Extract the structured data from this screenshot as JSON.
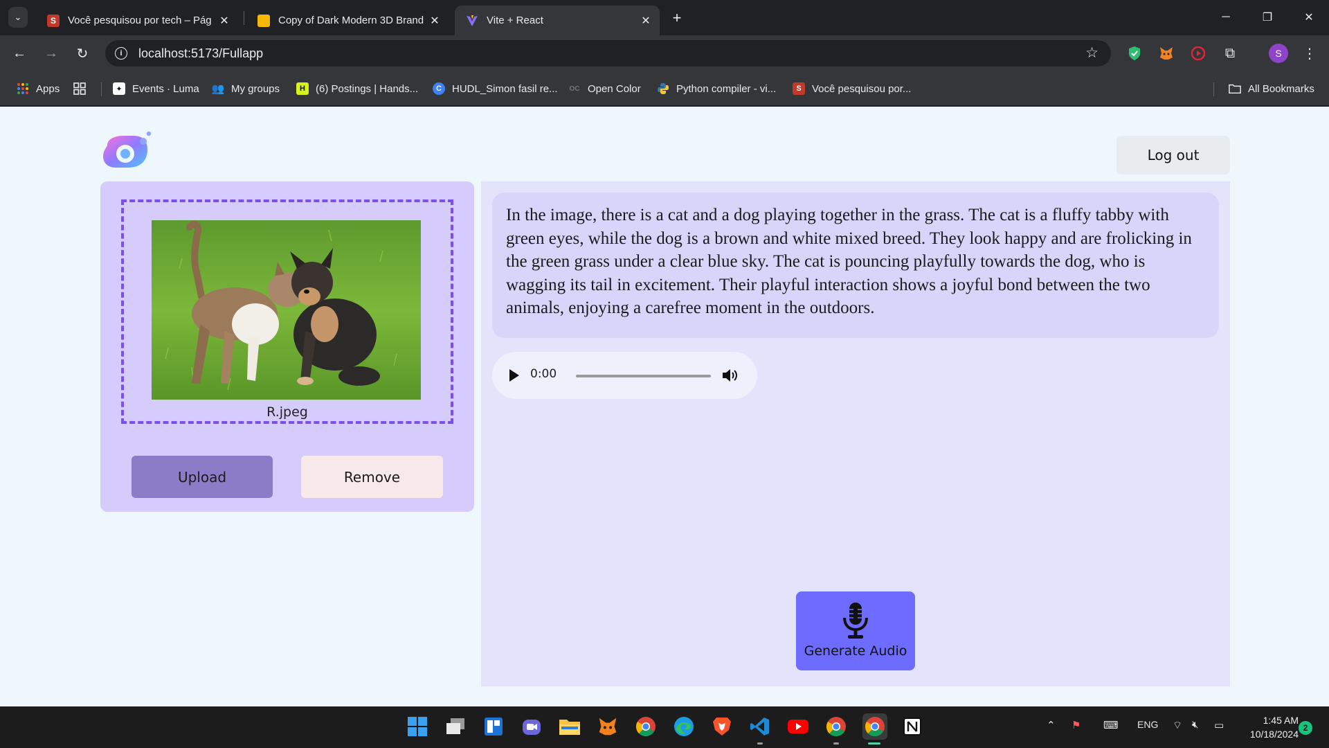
{
  "browser": {
    "tabs": [
      {
        "title": "Você pesquisou por tech – Pág",
        "favicon_letter": "S",
        "favicon_color": "#c0392b"
      },
      {
        "title": "Copy of Dark Modern 3D Brand",
        "favicon_letter": "",
        "favicon_color": "#f6b800"
      },
      {
        "title": "Vite + React",
        "favicon_letter": "",
        "favicon_color": "#8a6cff"
      }
    ],
    "url": "localhost:5173/Fullapp",
    "profile_initial": "S",
    "bookmarks": [
      {
        "label": "Apps",
        "icon": "apps-grid-icon"
      },
      {
        "label": "Events · Luma",
        "icon": "luma-icon"
      },
      {
        "label": "My groups",
        "icon": "groups-icon"
      },
      {
        "label": "(6) Postings | Hands...",
        "icon": "handshake-icon"
      },
      {
        "label": "HUDL_Simon fasil re...",
        "icon": "canva-icon"
      },
      {
        "label": "Open Color",
        "icon": "opencolor-icon"
      },
      {
        "label": "Python compiler - vi...",
        "icon": "python-icon"
      },
      {
        "label": "Você pesquisou por...",
        "icon": "s-icon"
      }
    ],
    "all_bookmarks": "All Bookmarks"
  },
  "app": {
    "logout_label": "Log out",
    "file_name": "R.jpeg",
    "upload_label": "Upload",
    "remove_label": "Remove",
    "description": "In the image, there is a cat and a dog playing together in the grass. The cat is a fluffy tabby with green eyes, while the dog is a brown and white mixed breed. They look happy and are frolicking in the green grass under a clear blue sky. The cat is pouncing playfully towards the dog, who is wagging its tail in excitement. Their playful interaction shows a joyful bond between the two animals, enjoying a carefree moment in the outdoors.",
    "audio": {
      "time": "0:00",
      "progress": 0.0
    },
    "generate_label": "Generate Audio",
    "colors": {
      "accent": "#6e6cff",
      "left_panel": "#d5ccfb",
      "dashed_border": "#7b4eee",
      "upload_btn": "#8a7cc6",
      "remove_btn": "#f7e8ea"
    }
  },
  "taskbar": {
    "language": "ENG",
    "time": "1:45 AM",
    "date": "10/18/2024",
    "notifications": "2"
  }
}
